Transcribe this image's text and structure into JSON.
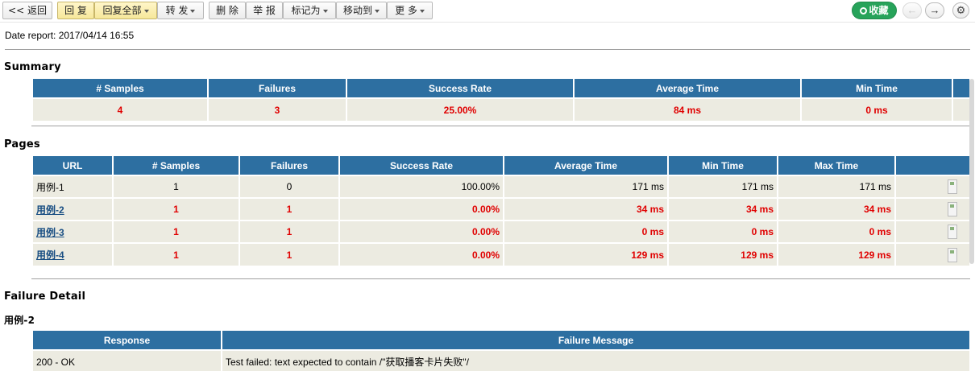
{
  "toolbar": {
    "back": "<< 返回",
    "reply": "回 复",
    "reply_all": "回复全部",
    "forward": "转 发",
    "delete": "删 除",
    "report": "举 报",
    "mark_as": "标记为",
    "move_to": "移动到",
    "more": "更 多",
    "favorite": "收藏",
    "prev_icon": "left-arrow-icon",
    "next_icon": "right-arrow-icon",
    "settings_icon": "gear-icon"
  },
  "date_report": "Date report: 2017/04/14 16:55",
  "summary": {
    "title": "Summary",
    "headers": [
      "# Samples",
      "Failures",
      "Success Rate",
      "Average Time",
      "Min Time"
    ],
    "values": [
      "4",
      "3",
      "25.00%",
      "84 ms",
      "0 ms"
    ]
  },
  "pages": {
    "title": "Pages",
    "headers": [
      "URL",
      "# Samples",
      "Failures",
      "Success Rate",
      "Average Time",
      "Min Time",
      "Max Time"
    ],
    "rows": [
      {
        "url": "用例-1",
        "samples": "1",
        "failures": "0",
        "rate": "100.00%",
        "avg": "171 ms",
        "min": "171 ms",
        "max": "171 ms",
        "failed": false
      },
      {
        "url": "用例-2",
        "samples": "1",
        "failures": "1",
        "rate": "0.00%",
        "avg": "34 ms",
        "min": "34 ms",
        "max": "34 ms",
        "failed": true
      },
      {
        "url": "用例-3",
        "samples": "1",
        "failures": "1",
        "rate": "0.00%",
        "avg": "0 ms",
        "min": "0 ms",
        "max": "0 ms",
        "failed": true
      },
      {
        "url": "用例-4",
        "samples": "1",
        "failures": "1",
        "rate": "0.00%",
        "avg": "129 ms",
        "min": "129 ms",
        "max": "129 ms",
        "failed": true
      }
    ]
  },
  "failure_detail": {
    "title": "Failure Detail",
    "case_title": "用例-2",
    "headers": [
      "Response",
      "Failure Message"
    ],
    "rows": [
      {
        "response": "200 - OK",
        "message": "Test failed: text expected to contain /\"获取播客卡片失败\"/"
      }
    ]
  },
  "colors": {
    "header_blue": "#2d6fa1",
    "row_bg": "#ecebe1",
    "fail_red": "#e00000",
    "favorite_green": "#27a35a"
  }
}
